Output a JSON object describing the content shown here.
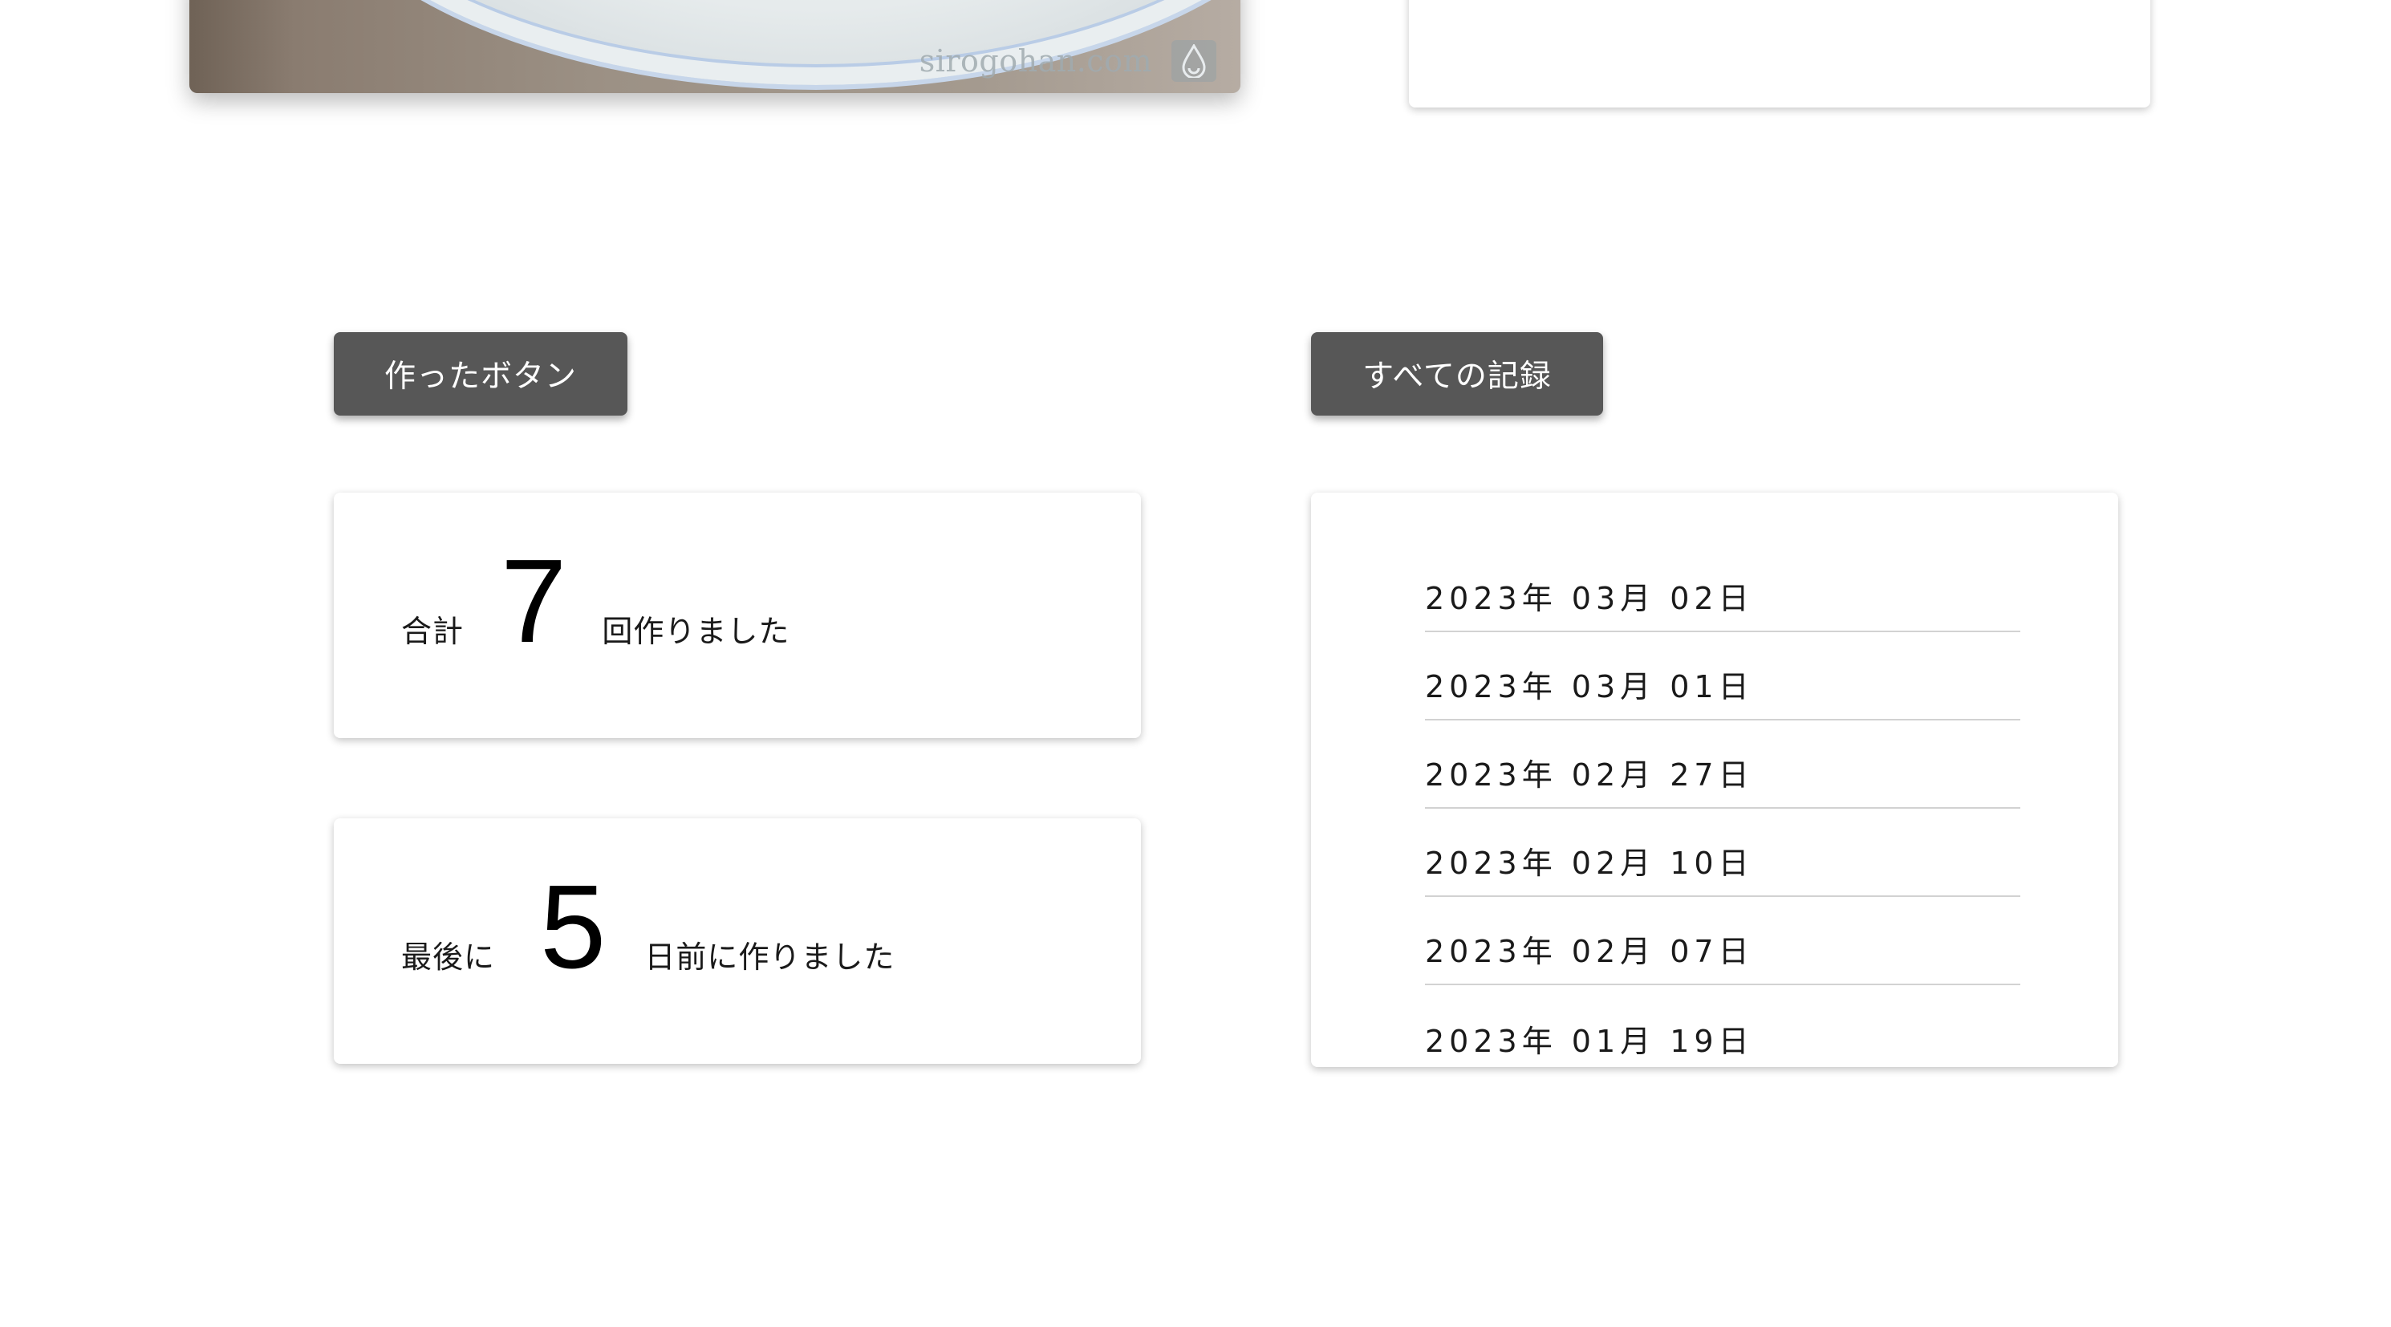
{
  "photo": {
    "watermark": "sirogohan.com",
    "watermark_icon": "water-drop-logo-icon"
  },
  "buttons": {
    "made": "作ったボタン",
    "records": "すべての記録"
  },
  "stats": {
    "total": {
      "prefix": "合計",
      "value": "7",
      "suffix": "回作りました"
    },
    "last": {
      "prefix": "最後に",
      "value": "5",
      "suffix": "日前に作りました"
    }
  },
  "records": [
    "2023年 03月 02日",
    "2023年 03月 01日",
    "2023年 02月 27日",
    "2023年 02月 10日",
    "2023年 02月 07日",
    "2023年 01月 19日"
  ],
  "colors": {
    "button_bg": "#575757",
    "button_text": "#ffffff",
    "divider": "#d2d2d2"
  }
}
